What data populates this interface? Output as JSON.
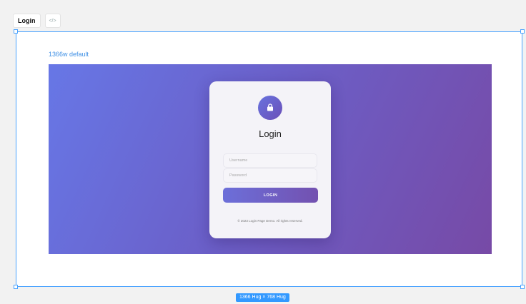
{
  "tabs": {
    "active_label": "Login",
    "code_label": "</>"
  },
  "frame": {
    "label": "1366w default",
    "size_badge": "1366 Hug × 768 Hug"
  },
  "login_card": {
    "icon": "lock-icon",
    "title": "Login",
    "username_placeholder": "Username",
    "password_placeholder": "Password",
    "button_label": "LOGIN",
    "footer": "© 2023 Login Page Demo. All rights reserved."
  },
  "colors": {
    "accent": "#4aa3ff",
    "gradient_start": "#6777e6",
    "gradient_end": "#774aa6",
    "card_bg": "#f4f3f8"
  }
}
